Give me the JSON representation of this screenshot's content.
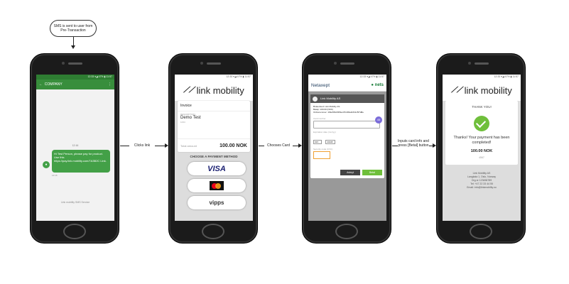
{
  "start_note": "SMS is sent to user from Pre-Transaction",
  "steps": {
    "clicks_link": "Clicks link",
    "chooses_card": "Chooses Card",
    "inputs_card": "Inputs card info and press [Betal] button"
  },
  "phone1": {
    "status": "12:33 ▾◢ 47% ▮ 11:57",
    "header_title": "COMPANY",
    "date": "12:16",
    "sms_text": "Hi Test Person, please pay for product. Use this https://pay.link.mobility.com/7A3B2C Link.",
    "sms_time": "12:16",
    "footer": "Link mobility SMS Service"
  },
  "phone2": {
    "status": "12:33 ▾◢ 47% ▮ 11:57",
    "logo_text": "link mobility",
    "invoice_title": "Invoice",
    "name_label": "DESCRIPTION",
    "name": "Demo Test",
    "sub": "1234",
    "total_label": "Total amount",
    "total_value": "100.00 NOK",
    "choose_label": "CHOOSE A PAYMENT METHOD",
    "visa": "VISA",
    "vipps": "vipps"
  },
  "phone3": {
    "status": "12:33 ▾◢ 47% ▮ 11:57",
    "brand": "Netaxept",
    "nets": "nets",
    "bar_title": "Link Mobility AS",
    "info1": "Brukersted: Link Mobility AS",
    "info2": "Beløp: 100.00 (NOK)",
    "info3": "Ordrenummer: 1b9e5f3c0954e47b4b5a1bf13c5f7d8e",
    "card_label": "Card number",
    "exp_label": "Expiration date (mm/yy)",
    "month": "01",
    "year": "2016",
    "cvc_label": "Security code (CVC)",
    "badge": "45",
    "cancel": "Avbryt",
    "pay": "Betal"
  },
  "phone4": {
    "status": "12:33 ▾◢ 47% ▮ 11:57",
    "logo_text": "link mobility",
    "title": "THANK YOU!",
    "message": "Thanks! Your payment has been completed!",
    "amount": "100.00 NOK",
    "code": "4567",
    "foot1": "Link Mobility AS",
    "foot2": "Langkaia 1, Oslo, Norway",
    "foot3": "Org.nr 123456789",
    "foot4": "Tel: +47 22 33 44 55",
    "foot5": "Email: info@linkmobility.no"
  }
}
